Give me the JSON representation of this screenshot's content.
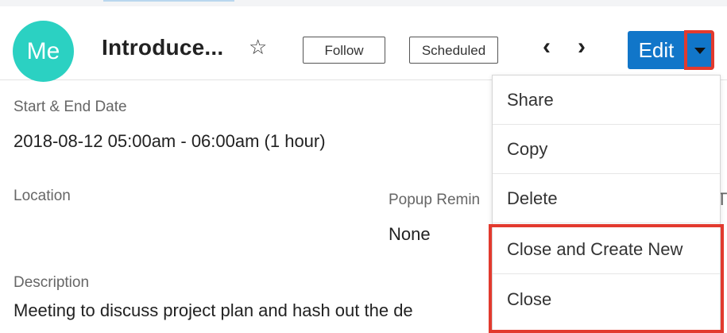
{
  "header": {
    "avatar_text": "Me",
    "title": "Introduce...",
    "follow_label": "Follow",
    "status_label": "Scheduled",
    "edit_label": "Edit"
  },
  "fields": {
    "dates_label": "Start & End Date",
    "dates_value": "2018-08-12 05:00am - 06:00am (1 hour)",
    "location_label": "Location",
    "popup_label": "Popup Remin",
    "popup_value": "None",
    "description_label": "Description",
    "description_value": "Meeting to discuss project plan and hash out the de"
  },
  "dropdown": {
    "items": [
      {
        "label": "Share"
      },
      {
        "label": "Copy"
      },
      {
        "label": "Delete"
      },
      {
        "label": "Close and Create New"
      },
      {
        "label": "Close"
      }
    ]
  },
  "colors": {
    "avatar": "#2bd1c2",
    "primary_button": "#1176c9",
    "highlight": "#e23a2e"
  },
  "icons": {
    "favorite": "star-icon",
    "previous": "chevron-left-icon",
    "next": "chevron-right-icon",
    "actions": "caret-down-icon"
  }
}
